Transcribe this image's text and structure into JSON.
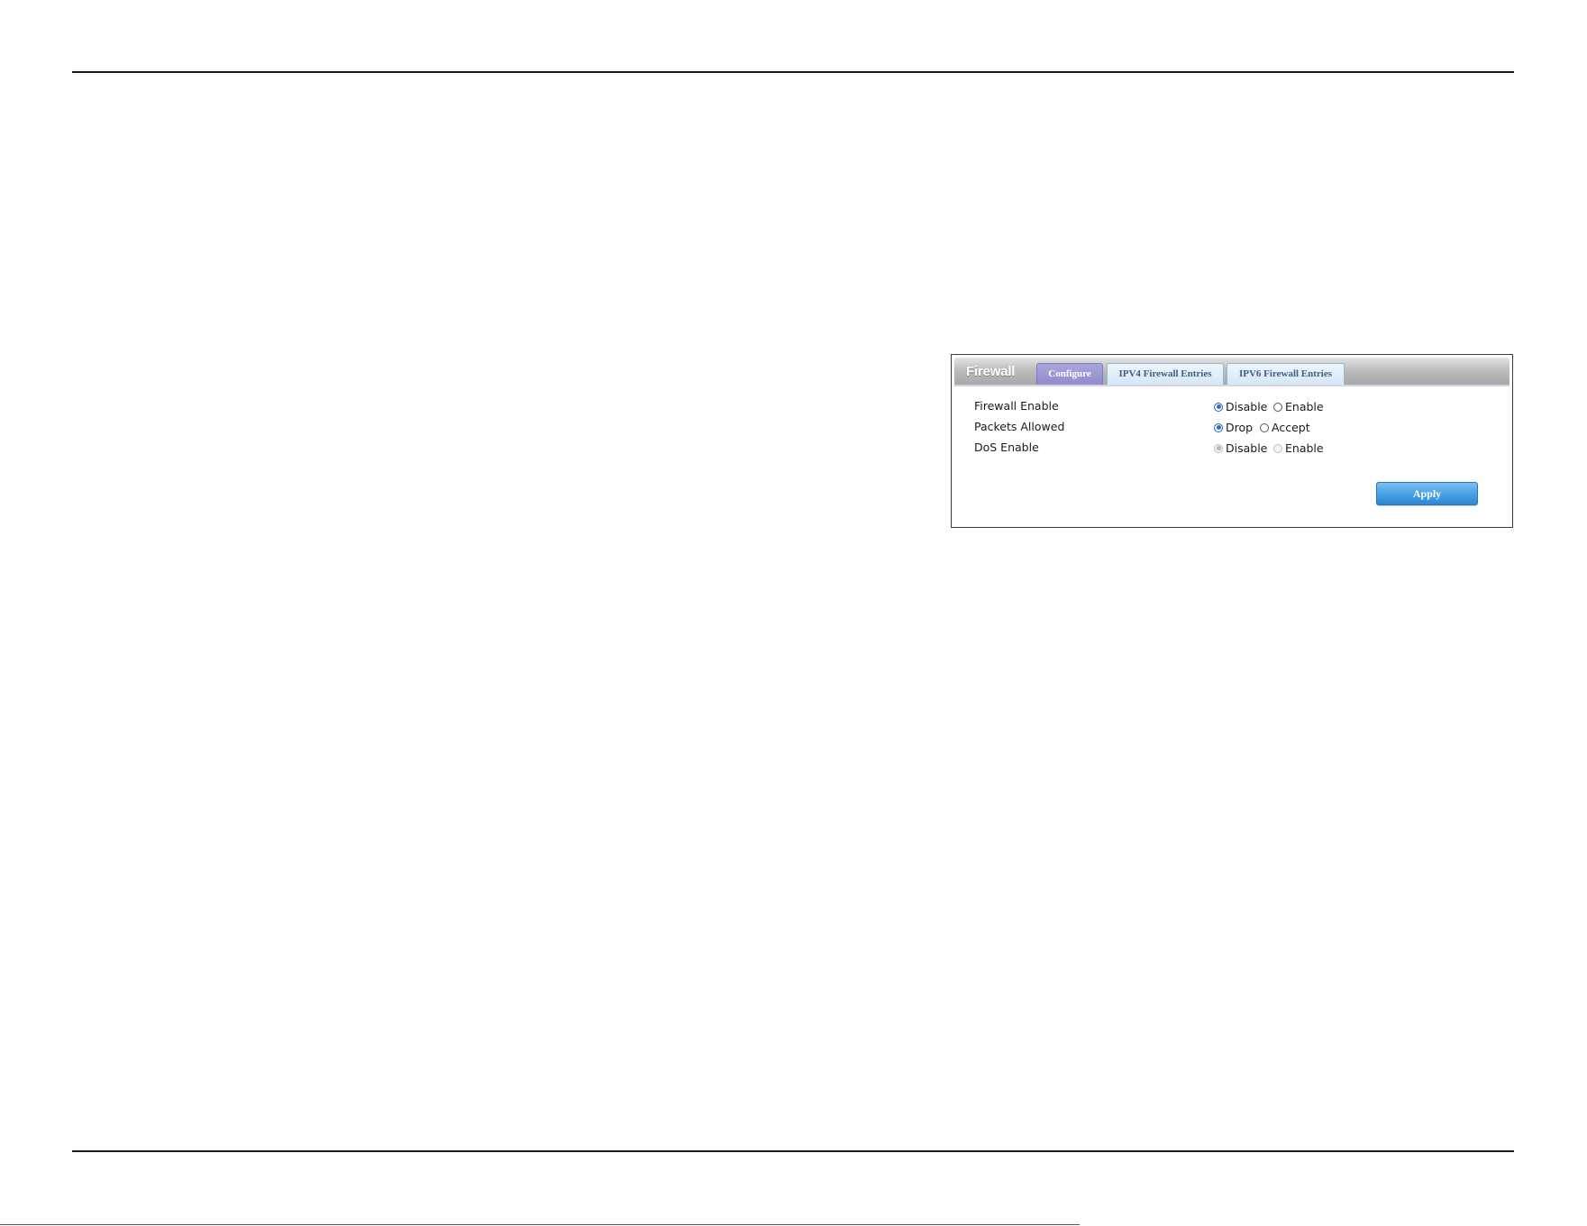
{
  "panel": {
    "title": "Firewall",
    "tabs": [
      {
        "label": "Configure",
        "active": true
      },
      {
        "label": "IPV4 Firewall Entries",
        "active": false
      },
      {
        "label": "IPV6 Firewall Entries",
        "active": false
      }
    ]
  },
  "settings": {
    "firewall_enable": {
      "label": "Firewall Enable",
      "options": [
        "Disable",
        "Enable"
      ],
      "selected": "Disable",
      "disabled": false
    },
    "packets_allowed": {
      "label": "Packets Allowed",
      "options": [
        "Drop",
        "Accept"
      ],
      "selected": "Drop",
      "disabled": false
    },
    "dos_enable": {
      "label": "DoS Enable",
      "options": [
        "Disable",
        "Enable"
      ],
      "selected": "Disable",
      "disabled": true
    }
  },
  "apply_label": "Apply",
  "colors": {
    "active_tab": "#8f8bcd",
    "inactive_tab_text": "#3d5f84",
    "apply_button": "#4aa1e4",
    "radio_selected": "#2f6bc8"
  }
}
